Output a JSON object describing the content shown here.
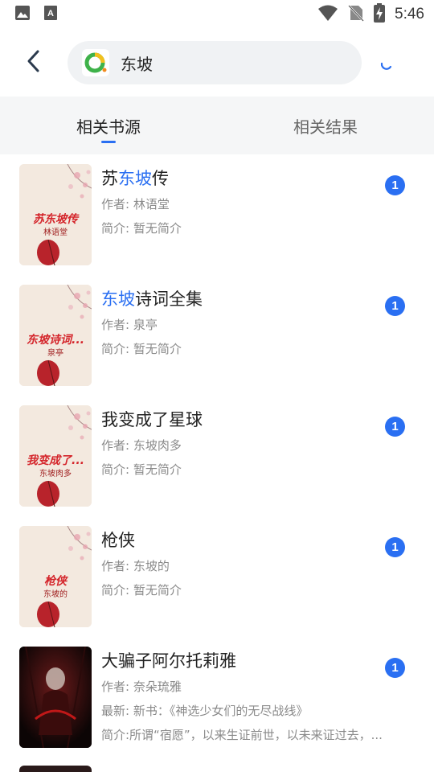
{
  "status_bar": {
    "time": "5:46",
    "icons": [
      "image-icon",
      "text-a-icon",
      "wifi-icon",
      "no-sim-icon",
      "battery-charging-icon"
    ]
  },
  "header": {
    "back_icon": "chevron-left-icon",
    "search_value": "东坡",
    "loading_icon": "loading-spinner-icon"
  },
  "tabs": [
    {
      "label": "相关书源",
      "active": true
    },
    {
      "label": "相关结果",
      "active": false
    }
  ],
  "colors": {
    "accent": "#2a6ff2",
    "tab_bg": "#f5f6f7",
    "search_bg": "#f0f2f4",
    "cover_title": "#d4242a"
  },
  "books": [
    {
      "title_parts": [
        "苏",
        "东坡",
        "传"
      ],
      "author": "作者: 林语堂",
      "intro": "简介: 暂无简介",
      "cover_title": "苏东坡传",
      "cover_author": "林语堂",
      "count": "1"
    },
    {
      "title_parts": [
        "",
        "东坡",
        "诗词全集"
      ],
      "author": "作者: 泉亭",
      "intro": "简介: 暂无简介",
      "cover_title": "东坡诗词...",
      "cover_author": "泉亭",
      "count": "1"
    },
    {
      "title_parts": [
        "我变成了星球",
        "",
        ""
      ],
      "author": "作者: 东坡肉多",
      "intro": "简介: 暂无简介",
      "cover_title": "我变成了...",
      "cover_author": "东坡肉多",
      "count": "1"
    },
    {
      "title_parts": [
        "枪侠",
        "",
        ""
      ],
      "author": "作者: 东坡的",
      "intro": "简介: 暂无简介",
      "cover_title": "枪侠",
      "cover_author": "东坡的",
      "count": "1"
    },
    {
      "title_parts": [
        "大骗子阿尔托莉雅",
        "",
        ""
      ],
      "author": "作者: 奈朵琉雅",
      "latest": "最新: 新书：《神选少女们的无尽战线》",
      "intro": "简介:所谓“宿愿”，以来生证前世，以未来证过去，...",
      "count": "1"
    }
  ]
}
